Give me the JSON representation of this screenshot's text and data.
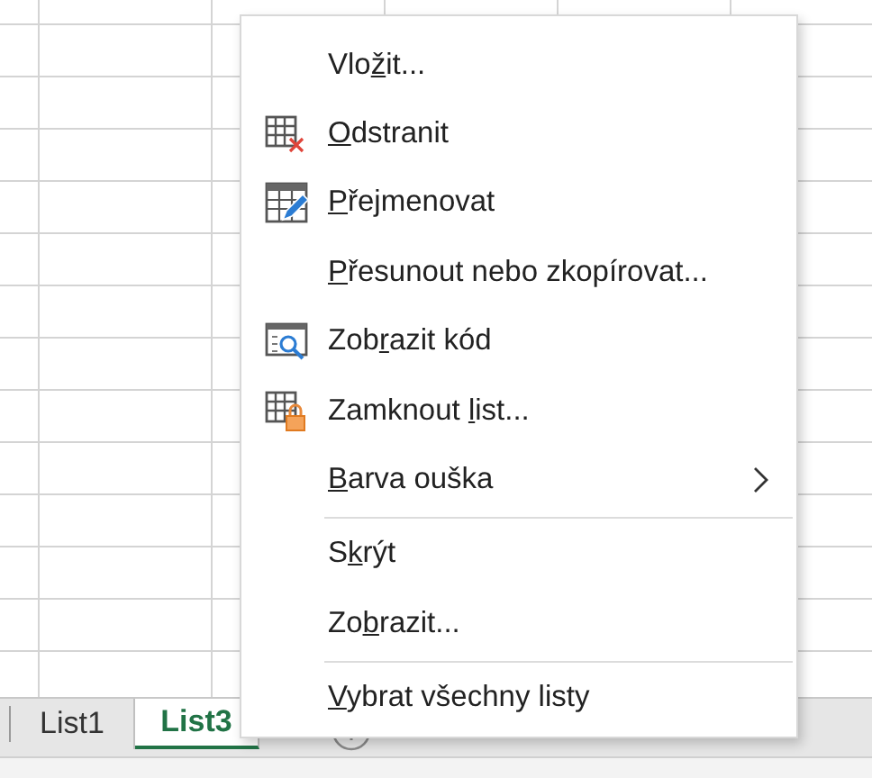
{
  "sheet_tabs": [
    {
      "label": "List1",
      "selected": false
    },
    {
      "label": "List3",
      "selected": true
    }
  ],
  "context_menu": {
    "items": [
      {
        "kind": "plain",
        "label_pre": "Vlo",
        "access_key": "ž",
        "label_post": "it..."
      },
      {
        "kind": "delete",
        "access_key": "O",
        "label_post": "dstranit"
      },
      {
        "kind": "rename",
        "access_key": "P",
        "label_post": "řejmenovat"
      },
      {
        "kind": "plain",
        "access_key": "P",
        "label_post": "řesunout nebo zkopírovat..."
      },
      {
        "kind": "view-code",
        "label_pre": "Zob",
        "access_key": "r",
        "label_post": "azit kód"
      },
      {
        "kind": "protect",
        "label_pre": "Zamknout ",
        "access_key": "l",
        "label_post": "ist..."
      },
      {
        "kind": "plain",
        "access_key": "B",
        "label_post": "arva ouška",
        "submenu": true
      },
      {
        "kind": "separator"
      },
      {
        "kind": "plain",
        "label_pre": "S",
        "access_key": "k",
        "label_post": "rýt"
      },
      {
        "kind": "plain",
        "label_pre": "Zo",
        "access_key": "b",
        "label_post": "razit..."
      },
      {
        "kind": "separator"
      },
      {
        "kind": "plain",
        "access_key": "V",
        "label_post": "ybrat všechny listy"
      }
    ]
  }
}
